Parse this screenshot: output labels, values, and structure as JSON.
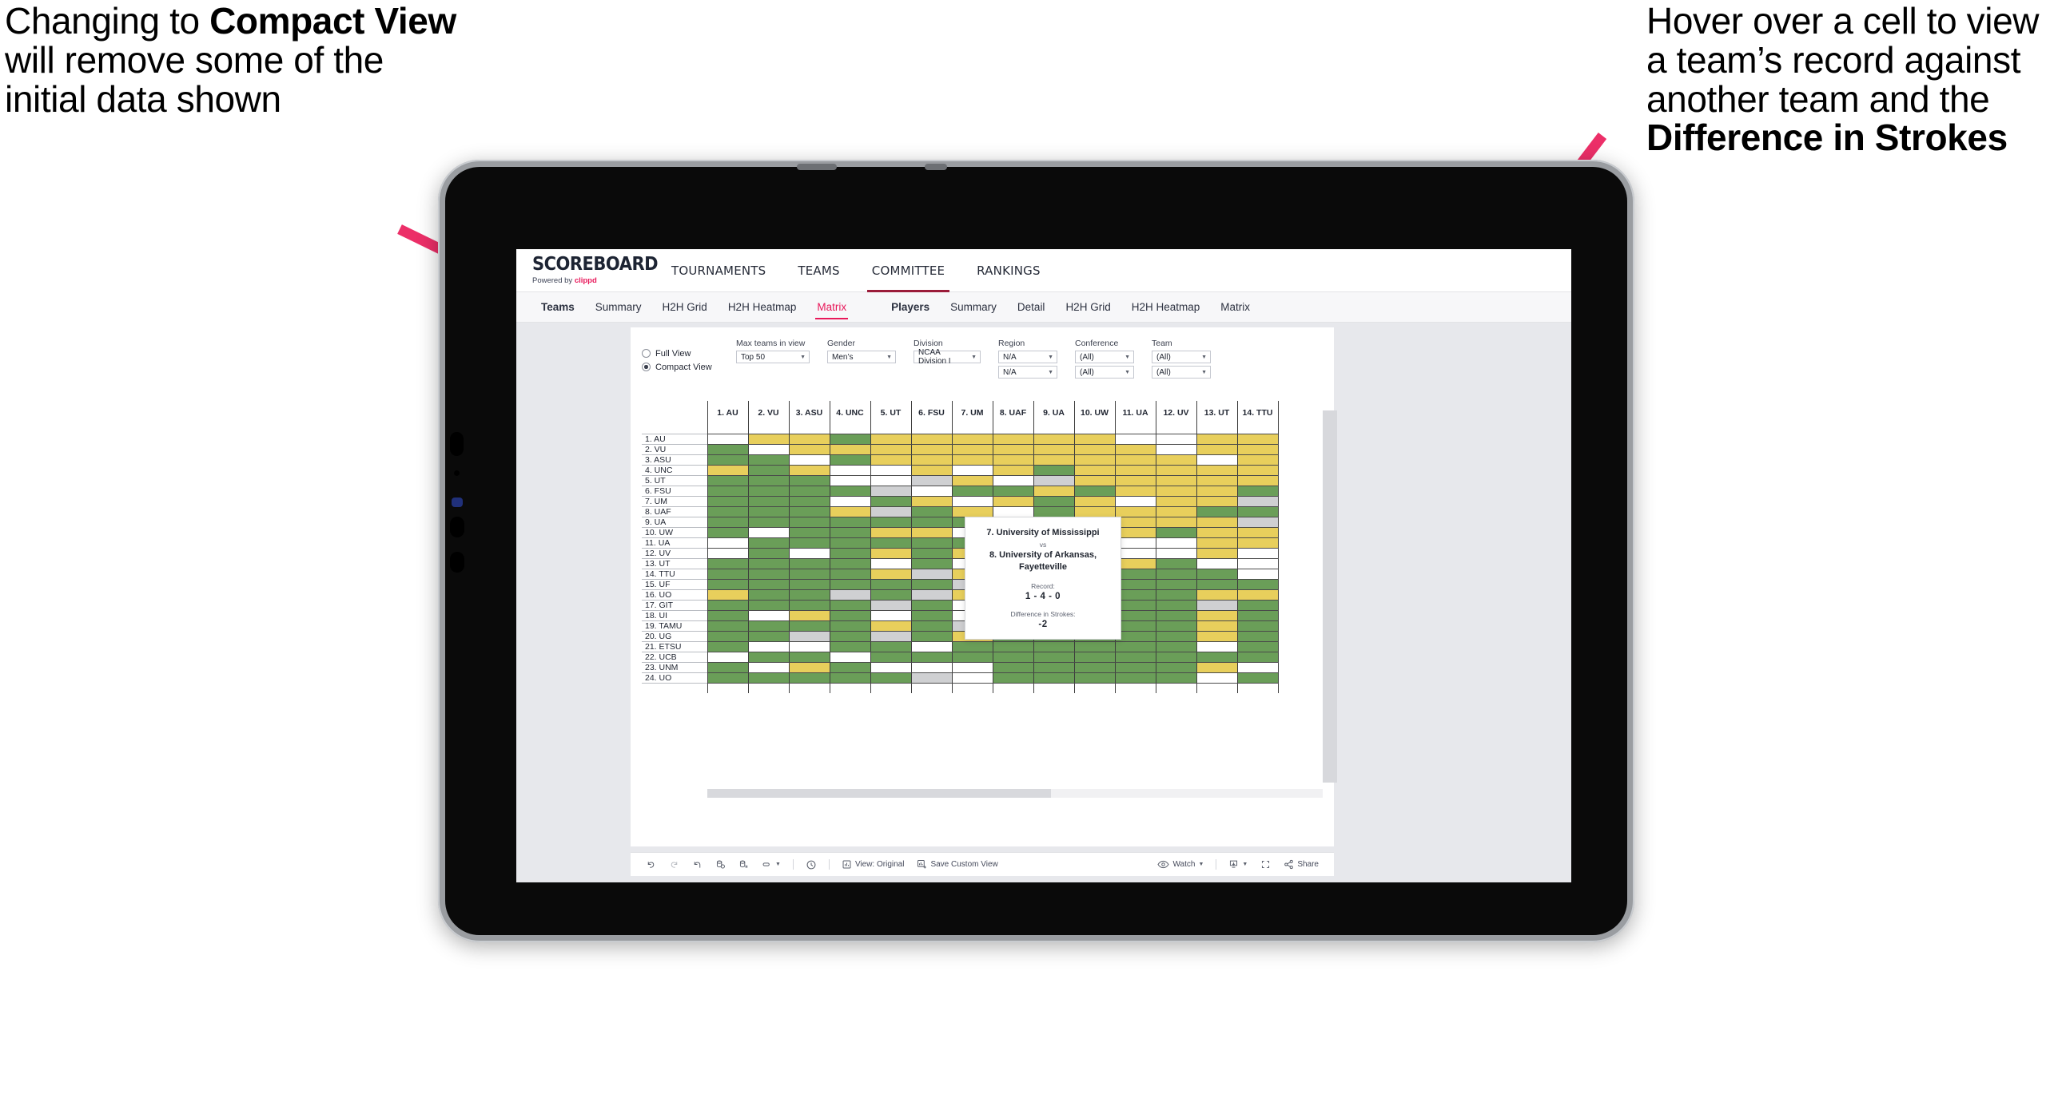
{
  "annotations": {
    "left": {
      "pre": "Changing to ",
      "bold": "Compact View",
      "post": " will remove some of the initial data shown"
    },
    "right": {
      "pre": "Hover over a cell to view a team’s record against another team and the ",
      "bold": "Difference in Strokes",
      "post": ""
    }
  },
  "app": {
    "logo": {
      "word": "SCOREBOARD",
      "powered_prefix": "Powered by ",
      "powered_brand": "clippd"
    },
    "topnav": [
      {
        "label": "TOURNAMENTS",
        "active": false
      },
      {
        "label": "TEAMS",
        "active": false
      },
      {
        "label": "COMMITTEE",
        "active": true
      },
      {
        "label": "RANKINGS",
        "active": false
      }
    ],
    "subnav_teams": [
      {
        "label": "Teams",
        "head": true,
        "selected": false
      },
      {
        "label": "Summary",
        "head": false,
        "selected": false
      },
      {
        "label": "H2H Grid",
        "head": false,
        "selected": false
      },
      {
        "label": "H2H Heatmap",
        "head": false,
        "selected": false
      },
      {
        "label": "Matrix",
        "head": false,
        "selected": true
      }
    ],
    "subnav_players": [
      {
        "label": "Players",
        "head": true,
        "selected": false
      },
      {
        "label": "Summary",
        "head": false,
        "selected": false
      },
      {
        "label": "Detail",
        "head": false,
        "selected": false
      },
      {
        "label": "H2H Grid",
        "head": false,
        "selected": false
      },
      {
        "label": "H2H Heatmap",
        "head": false,
        "selected": false
      },
      {
        "label": "Matrix",
        "head": false,
        "selected": false
      }
    ]
  },
  "filters": {
    "view_mode": {
      "full_label": "Full View",
      "compact_label": "Compact View",
      "selected": "Compact View"
    },
    "max_teams": {
      "label": "Max teams in view",
      "value": "Top 50"
    },
    "gender": {
      "label": "Gender",
      "value": "Men’s"
    },
    "division": {
      "label": "Division",
      "value": "NCAA Division I"
    },
    "region": {
      "label": "Region",
      "value1": "N/A",
      "value2": "N/A"
    },
    "conference": {
      "label": "Conference",
      "value1": "(All)",
      "value2": "(All)"
    },
    "team": {
      "label": "Team",
      "value1": "(All)",
      "value2": "(All)"
    }
  },
  "tooltip": {
    "team_a": "7. University of Mississippi",
    "vs": "vs",
    "team_b": "8. University of Arkansas, Fayetteville",
    "record_label": "Record:",
    "record_value": "1 - 4 - 0",
    "strokes_label": "Difference in Strokes:",
    "strokes_value": "-2"
  },
  "toolbar": {
    "undo": "undo-icon",
    "redo": "redo-icon",
    "revert": "revert-icon",
    "refresh": "refresh-data-icon",
    "pause": "pause-auto-update-icon",
    "view_original_label": "View: Original",
    "save_custom_view_label": "Save Custom View",
    "watch_label": "Watch",
    "share_label": "Share"
  },
  "chart_data": {
    "type": "heatmap",
    "title": "Team Head-to-Head Matrix",
    "legend_colors": {
      "win": "#6a9e58",
      "loss": "#e8cf5c",
      "tie_or_na": "#cfd0d2",
      "none": "#ffffff"
    },
    "columns": [
      "1. AU",
      "2. VU",
      "3. ASU",
      "4. UNC",
      "5. UT",
      "6. FSU",
      "7. UM",
      "8. UAF",
      "9. UA",
      "10. UW",
      "11. UA",
      "12. UV",
      "13. UT",
      "14. TTU"
    ],
    "rows": [
      "1. AU",
      "2. VU",
      "3. ASU",
      "4. UNC",
      "5. UT",
      "6. FSU",
      "7. UM",
      "8. UAF",
      "9. UA",
      "10. UW",
      "11. UA",
      "12. UV",
      "13. UT",
      "14. TTU",
      "15. UF",
      "16. UO",
      "17. GIT",
      "18. UI",
      "19. TAMU",
      "20. UG",
      "21. ETSU",
      "22. UCB",
      "23. UNM",
      "24. UO"
    ],
    "cells": [
      [
        "w",
        "y",
        "y",
        "g",
        "y",
        "y",
        "y",
        "y",
        "y",
        "y",
        "w",
        "w",
        "y",
        "y"
      ],
      [
        "g",
        "w",
        "y",
        "y",
        "y",
        "y",
        "y",
        "y",
        "y",
        "y",
        "y",
        "w",
        "y",
        "y"
      ],
      [
        "g",
        "g",
        "w",
        "g",
        "y",
        "y",
        "y",
        "y",
        "y",
        "y",
        "y",
        "y",
        "w",
        "y"
      ],
      [
        "y",
        "g",
        "y",
        "w",
        "w",
        "y",
        "w",
        "y",
        "g",
        "y",
        "y",
        "y",
        "y",
        "y"
      ],
      [
        "g",
        "g",
        "g",
        "w",
        "w",
        "s",
        "y",
        "w",
        "s",
        "y",
        "y",
        "y",
        "y",
        "y"
      ],
      [
        "g",
        "g",
        "g",
        "g",
        "s",
        "w",
        "g",
        "g",
        "y",
        "g",
        "y",
        "y",
        "y",
        "g"
      ],
      [
        "g",
        "g",
        "g",
        "w",
        "g",
        "y",
        "w",
        "y",
        "g",
        "y",
        "w",
        "y",
        "y",
        "s"
      ],
      [
        "g",
        "g",
        "g",
        "y",
        "s",
        "g",
        "y",
        "w",
        "g",
        "y",
        "y",
        "y",
        "g",
        "g"
      ],
      [
        "g",
        "g",
        "g",
        "g",
        "g",
        "g",
        "g",
        "w",
        "w",
        "y",
        "y",
        "y",
        "y",
        "s"
      ],
      [
        "g",
        "w",
        "g",
        "g",
        "y",
        "y",
        "w",
        "g",
        "g",
        "w",
        "y",
        "g",
        "y",
        "y"
      ],
      [
        "w",
        "g",
        "g",
        "g",
        "g",
        "g",
        "g",
        "y",
        "g",
        "g",
        "w",
        "w",
        "y",
        "y"
      ],
      [
        "w",
        "g",
        "w",
        "g",
        "y",
        "g",
        "y",
        "g",
        "y",
        "y",
        "w",
        "w",
        "y",
        "w"
      ],
      [
        "g",
        "g",
        "g",
        "g",
        "w",
        "g",
        "w",
        "g",
        "g",
        "y",
        "y",
        "g",
        "w",
        "w"
      ],
      [
        "g",
        "g",
        "g",
        "g",
        "y",
        "s",
        "y",
        "g",
        "g",
        "g",
        "g",
        "g",
        "g",
        "w"
      ],
      [
        "g",
        "g",
        "g",
        "g",
        "g",
        "g",
        "s",
        "w",
        "g",
        "g",
        "g",
        "g",
        "g",
        "g"
      ],
      [
        "y",
        "g",
        "g",
        "s",
        "g",
        "s",
        "y",
        "g",
        "y",
        "g",
        "g",
        "g",
        "y",
        "y"
      ],
      [
        "g",
        "g",
        "g",
        "g",
        "s",
        "g",
        "w",
        "g",
        "g",
        "g",
        "g",
        "g",
        "s",
        "g"
      ],
      [
        "g",
        "w",
        "y",
        "g",
        "w",
        "g",
        "w",
        "g",
        "g",
        "g",
        "g",
        "g",
        "y",
        "g"
      ],
      [
        "g",
        "g",
        "g",
        "g",
        "y",
        "g",
        "s",
        "g",
        "g",
        "g",
        "g",
        "g",
        "y",
        "g"
      ],
      [
        "g",
        "g",
        "s",
        "g",
        "s",
        "g",
        "y",
        "g",
        "g",
        "g",
        "g",
        "g",
        "y",
        "g"
      ],
      [
        "g",
        "w",
        "w",
        "g",
        "g",
        "w",
        "g",
        "g",
        "g",
        "g",
        "g",
        "g",
        "w",
        "g"
      ],
      [
        "w",
        "g",
        "g",
        "w",
        "g",
        "g",
        "g",
        "g",
        "g",
        "g",
        "g",
        "g",
        "g",
        "g"
      ],
      [
        "g",
        "w",
        "y",
        "g",
        "w",
        "w",
        "w",
        "g",
        "g",
        "g",
        "g",
        "g",
        "y",
        "w"
      ],
      [
        "g",
        "g",
        "g",
        "g",
        "g",
        "s",
        "w",
        "g",
        "g",
        "g",
        "g",
        "g",
        "w",
        "g"
      ]
    ]
  }
}
